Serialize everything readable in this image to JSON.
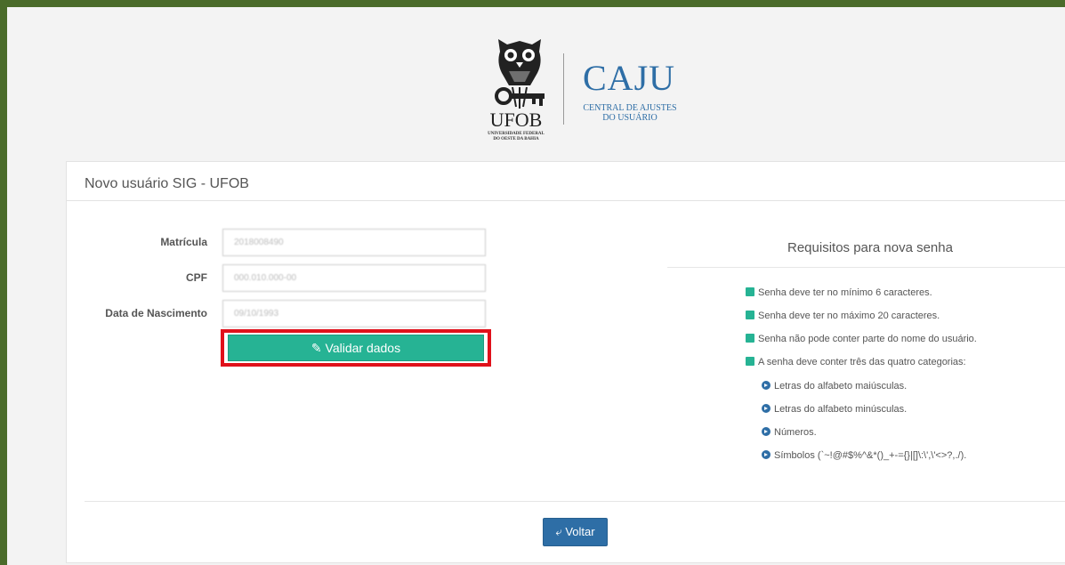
{
  "logo": {
    "ufob": "UFOB",
    "ufob_subtitle_line1": "UNIVERSIDADE FEDERAL",
    "ufob_subtitle_line2": "DO OESTE DA BAHIA",
    "caju": "CAJU",
    "caju_subtitle_line1": "CENTRAL DE AJUSTES",
    "caju_subtitle_line2": "DO USUÁRIO"
  },
  "panel": {
    "title": "Novo usuário SIG - UFOB"
  },
  "form": {
    "matricula_label": "Matrícula",
    "matricula_value": "2018008490",
    "cpf_label": "CPF",
    "cpf_value": "000.010.000-00",
    "nascimento_label": "Data de Nascimento",
    "nascimento_value": "09/10/1993",
    "validate_label": "Validar dados"
  },
  "requirements": {
    "title": "Requisitos para nova senha",
    "items": [
      "Senha deve ter no mínimo 6 caracteres.",
      "Senha deve ter no máximo 20 caracteres.",
      "Senha não pode conter parte do nome do usuário.",
      "A senha deve conter três das quatro categorias:"
    ],
    "categories": [
      "Letras do alfabeto maiúsculas.",
      "Letras do alfabeto minúsculas.",
      "Números.",
      "Símbolos (`~!@#$%^&*()_+-={}|[]\\:\\',\\'<>?,./)."
    ]
  },
  "footer": {
    "back_label": "Voltar"
  },
  "colors": {
    "accent_green": "#26b394",
    "accent_blue": "#2e6ea6",
    "highlight_red": "#e0111b"
  }
}
